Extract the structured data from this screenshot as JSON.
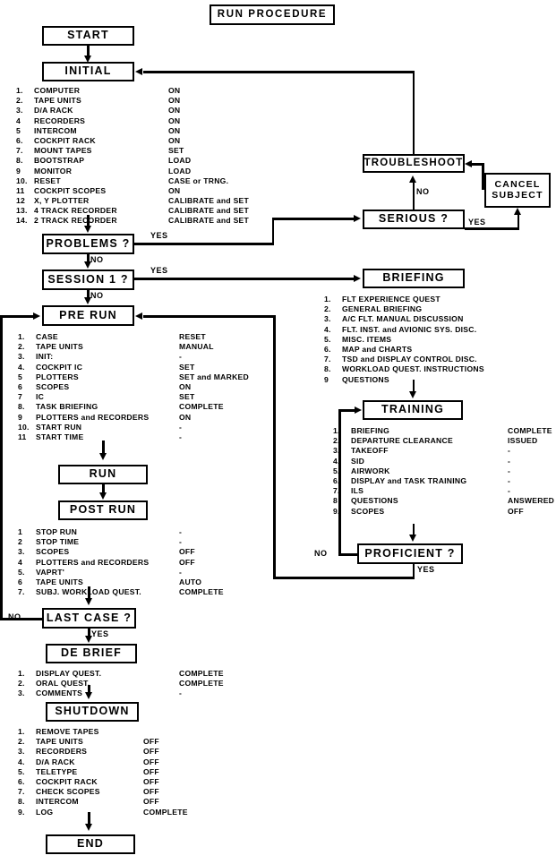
{
  "title": "RUN  PROCEDURE",
  "nodes": {
    "start": "START",
    "initial": "INITIAL",
    "problems": "PROBLEMS ?",
    "session1": "SESSION 1 ?",
    "prerun": "PRE RUN",
    "run": "RUN",
    "postrun": "POST  RUN",
    "lastcase": "LAST CASE ?",
    "debrief": "DE BRIEF",
    "shutdown": "SHUTDOWN",
    "end": "END",
    "troubleshoot": "TROUBLESHOOT",
    "cancel_subject": "CANCEL\nSUBJECT",
    "serious": "SERIOUS ?",
    "briefing": "BRIEFING",
    "training": "TRAINING",
    "proficient": "PROFICIENT ?"
  },
  "edge_labels": {
    "problems_yes": "YES",
    "problems_no": "NO",
    "session_yes": "YES",
    "session_no": "NO",
    "serious_no": "NO",
    "serious_yes": "YES",
    "proficient_no": "NO",
    "proficient_yes": "YES",
    "lastcase_no": "NO",
    "lastcase_yes": "YES"
  },
  "checklists": {
    "initial": [
      {
        "num": "1.",
        "name": "COMPUTER",
        "value": "ON"
      },
      {
        "num": "2.",
        "name": "TAPE UNITS",
        "value": "ON"
      },
      {
        "num": "3.",
        "name": "D/A RACK",
        "value": "ON"
      },
      {
        "num": "4",
        "name": "RECORDERS",
        "value": "ON"
      },
      {
        "num": "5",
        "name": "INTERCOM",
        "value": "ON"
      },
      {
        "num": "6.",
        "name": "COCKPIT RACK",
        "value": "ON"
      },
      {
        "num": "7.",
        "name": "MOUNT TAPES",
        "value": "SET"
      },
      {
        "num": "8.",
        "name": "BOOTSTRAP",
        "value": "LOAD"
      },
      {
        "num": "9",
        "name": "MONITOR",
        "value": "LOAD"
      },
      {
        "num": "10.",
        "name": "RESET",
        "value": "CASE or TRNG."
      },
      {
        "num": "11",
        "name": "COCKPIT SCOPES",
        "value": "ON"
      },
      {
        "num": "12",
        "name": "X, Y PLOTTER",
        "value": "CALIBRATE and SET"
      },
      {
        "num": "13.",
        "name": "4 TRACK RECORDER",
        "value": "CALIBRATE and SET"
      },
      {
        "num": "14.",
        "name": "2 TRACK RECORDER",
        "value": "CALIBRATE and SET"
      }
    ],
    "prerun": [
      {
        "num": "1.",
        "name": "CASE",
        "value": "RESET"
      },
      {
        "num": "2.",
        "name": "TAPE UNITS",
        "value": "MANUAL"
      },
      {
        "num": "3.",
        "name": "INIT:",
        "value": "-"
      },
      {
        "num": "4.",
        "name": "COCKPIT IC",
        "value": "SET"
      },
      {
        "num": "5",
        "name": "PLOTTERS",
        "value": "SET and MARKED"
      },
      {
        "num": "6",
        "name": "SCOPES",
        "value": "ON"
      },
      {
        "num": "7",
        "name": "IC",
        "value": "SET"
      },
      {
        "num": "8.",
        "name": "TASK BRIEFING",
        "value": "COMPLETE"
      },
      {
        "num": "9",
        "name": "PLOTTERS and RECORDERS",
        "value": "ON"
      },
      {
        "num": "10.",
        "name": "START RUN",
        "value": "-"
      },
      {
        "num": "11",
        "name": "START TIME",
        "value": "-"
      }
    ],
    "postrun": [
      {
        "num": "1",
        "name": "STOP RUN",
        "value": "-"
      },
      {
        "num": "2",
        "name": "STOP TIME",
        "value": "-"
      },
      {
        "num": "3.",
        "name": "SCOPES",
        "value": "OFF"
      },
      {
        "num": "4",
        "name": "PLOTTERS and RECORDERS",
        "value": "OFF"
      },
      {
        "num": "5.",
        "name": "VAPRT'",
        "value": "-"
      },
      {
        "num": "6",
        "name": "TAPE UNITS",
        "value": "AUTO"
      },
      {
        "num": "7.",
        "name": "SUBJ. WORKLOAD QUEST.",
        "value": "COMPLETE"
      }
    ],
    "debrief": [
      {
        "num": "1.",
        "name": "DISPLAY QUEST.",
        "value": "COMPLETE"
      },
      {
        "num": "2.",
        "name": "ORAL QUEST.",
        "value": "COMPLETE"
      },
      {
        "num": "3.",
        "name": "COMMENTS",
        "value": "-"
      }
    ],
    "shutdown": [
      {
        "num": "1.",
        "name": "REMOVE TAPES",
        "value": ""
      },
      {
        "num": "2.",
        "name": "TAPE UNITS",
        "value": "OFF"
      },
      {
        "num": "3.",
        "name": "RECORDERS",
        "value": "OFF"
      },
      {
        "num": "4.",
        "name": "D/A RACK",
        "value": "OFF"
      },
      {
        "num": "5.",
        "name": "TELETYPE",
        "value": "OFF"
      },
      {
        "num": "6.",
        "name": "COCKPIT RACK",
        "value": "OFF"
      },
      {
        "num": "7.",
        "name": "CHECK SCOPES",
        "value": "OFF"
      },
      {
        "num": "8.",
        "name": "INTERCOM",
        "value": "OFF"
      },
      {
        "num": "9.",
        "name": "LOG",
        "value": "COMPLETE"
      }
    ],
    "briefing": [
      {
        "num": "1.",
        "name": "FLT EXPERIENCE QUEST",
        "value": ""
      },
      {
        "num": "2.",
        "name": "GENERAL BRIEFING",
        "value": ""
      },
      {
        "num": "3.",
        "name": "A/C FLT. MANUAL DISCUSSION",
        "value": ""
      },
      {
        "num": "4.",
        "name": "FLT. INST. and AVIONIC SYS. DISC.",
        "value": ""
      },
      {
        "num": "5.",
        "name": "MISC. ITEMS",
        "value": ""
      },
      {
        "num": "6.",
        "name": "MAP and CHARTS",
        "value": ""
      },
      {
        "num": "7.",
        "name": "TSD and DISPLAY CONTROL DISC.",
        "value": ""
      },
      {
        "num": "8.",
        "name": "WORKLOAD QUEST. INSTRUCTIONS",
        "value": ""
      },
      {
        "num": "9",
        "name": "QUESTIONS",
        "value": ""
      }
    ],
    "training": [
      {
        "num": "1.",
        "name": "BRIEFING",
        "value": "COMPLETE"
      },
      {
        "num": "2.",
        "name": "DEPARTURE CLEARANCE",
        "value": "ISSUED"
      },
      {
        "num": "3.",
        "name": "TAKEOFF",
        "value": "-"
      },
      {
        "num": "4.",
        "name": "SID",
        "value": "-"
      },
      {
        "num": "5.",
        "name": "AIRWORK",
        "value": "-"
      },
      {
        "num": "6.",
        "name": "DISPLAY and TASK TRAINING",
        "value": "-"
      },
      {
        "num": "7.",
        "name": "ILS",
        "value": "-"
      },
      {
        "num": "8",
        "name": "QUESTIONS",
        "value": "ANSWERED"
      },
      {
        "num": "9.",
        "name": "SCOPES",
        "value": "OFF"
      }
    ]
  }
}
